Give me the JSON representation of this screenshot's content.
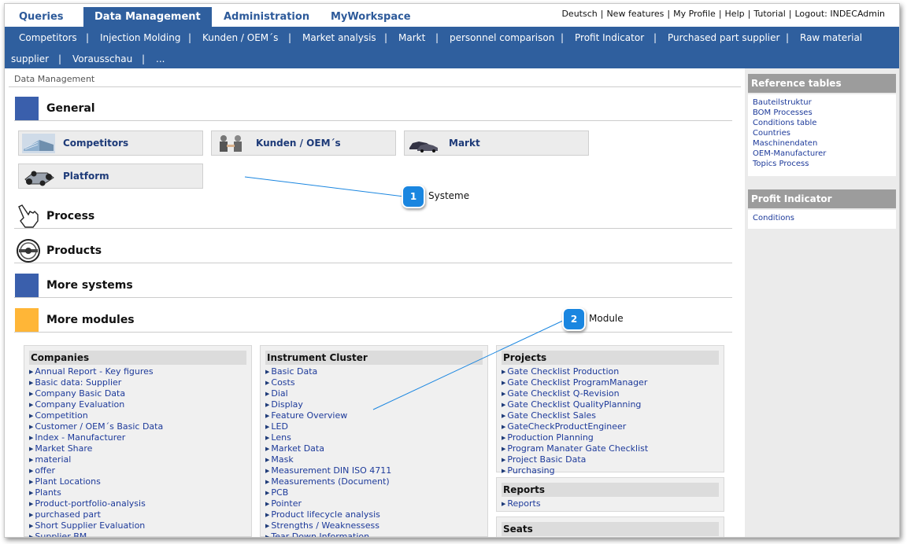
{
  "top_tabs": [
    "Queries",
    "Data Management",
    "Administration",
    "MyWorkspace"
  ],
  "top_links": [
    "Deutsch",
    "New features",
    "My Profile",
    "Help",
    "Tutorial",
    "Logout: INDECAdmin"
  ],
  "subnav": {
    "row1": [
      "Competitors",
      "Injection Molding",
      "Kunden / OEM´s",
      "Market analysis",
      "Markt",
      "personnel comparison",
      "Profit Indicator",
      "Purchased part supplier",
      "Raw material"
    ],
    "row2": [
      "supplier",
      "Vorausschau",
      "..."
    ]
  },
  "breadcrumb": "Data Management",
  "sections": {
    "general": "General",
    "process": "Process",
    "products": "Products",
    "more_systems": "More systems",
    "more_modules": "More modules"
  },
  "systems": [
    "Competitors",
    "Kunden / OEM´s",
    "Markt",
    "Platform"
  ],
  "modules": {
    "companies": {
      "title": "Companies",
      "items": [
        "Annual Report - Key figures",
        "Basic data: Supplier",
        "Company Basic Data",
        "Company Evaluation",
        "Competition",
        "Customer / OEM´s Basic Data",
        "Index - Manufacturer",
        "Market Share",
        "material",
        "offer",
        "Plant Locations",
        "Plants",
        "Product-portfolio-analysis",
        "purchased part",
        "Short Supplier Evaluation",
        "Supplier BM"
      ]
    },
    "instrument_cluster": {
      "title": "Instrument Cluster",
      "items": [
        "Basic Data",
        "Costs",
        "Dial",
        "Display",
        "Feature Overview",
        "LED",
        "Lens",
        "Market Data",
        "Mask",
        "Measurement DIN ISO 4711",
        "Measurements (Document)",
        "PCB",
        "Pointer",
        "Product lifecycle analysis",
        "Strengths / Weaknessess",
        "Tear Down Information"
      ]
    },
    "projects": {
      "title": "Projects",
      "items": [
        "Gate Checklist Production",
        "Gate Checklist ProgramManager",
        "Gate Checklist Q-Revision",
        "Gate Checklist QualityPlanning",
        "Gate Checklist Sales",
        "GateCheckProductEngineer",
        "Production Planning",
        "Program Manater Gate Checklist",
        "Project Basic Data",
        "Purchasing"
      ]
    },
    "reports": {
      "title": "Reports",
      "items": [
        "Reports"
      ]
    },
    "seats": {
      "title": "Seats",
      "items": []
    }
  },
  "sidebar": {
    "reference_tables": {
      "title": "Reference tables",
      "items": [
        "Bauteilstruktur",
        "BOM Processes",
        "Conditions table",
        "Countries",
        "Maschinendaten",
        "OEM-Manufacturer",
        "Topics Process"
      ]
    },
    "profit_indicator": {
      "title": "Profit Indicator",
      "items": [
        "Conditions"
      ]
    }
  },
  "callouts": [
    {
      "number": "1",
      "label": "Systeme"
    },
    {
      "number": "2",
      "label": "Module"
    }
  ],
  "colors": {
    "nav_blue": "#2f5f9e",
    "section_blue": "#3a5fac",
    "section_orange": "#ffb637",
    "callout_blue": "#1a86e0",
    "link_blue": "#1d3a9a"
  }
}
